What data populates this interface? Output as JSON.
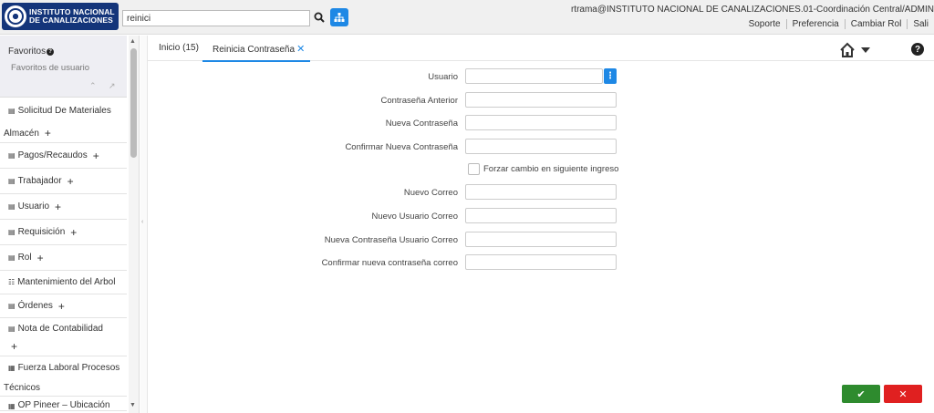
{
  "header": {
    "logo_line1": "INSTITUTO NACIONAL",
    "logo_line2": "DE CANALIZACIONES",
    "search_value": "reinici",
    "user_info": "rtrama@INSTITUTO NACIONAL DE CANALIZACIONES.01-Coordinación Central/ADMIN",
    "links": [
      "Soporte",
      "Preferencia",
      "Cambiar Rol",
      "Sali"
    ]
  },
  "sidebar": {
    "favorites_title": "Favoritos",
    "favorites_subtitle": "Favoritos de usuario",
    "items": [
      {
        "label": "Solicitud De Materiales",
        "label2": "Almacén"
      },
      {
        "label": "Pagos/Recaudos"
      },
      {
        "label": "Trabajador"
      },
      {
        "label": "Usuario"
      },
      {
        "label": "Requisición"
      },
      {
        "label": "Rol"
      },
      {
        "label": "Mantenimiento del Arbol"
      },
      {
        "label": "Órdenes"
      },
      {
        "label": "Nota de Contabilidad"
      },
      {
        "label": "Fuerza Laboral Procesos",
        "label2": "Técnicos"
      },
      {
        "label": "OP Pineer – Ubicación"
      }
    ]
  },
  "tabs": [
    {
      "label": "Inicio (15)"
    },
    {
      "label": "Reinicia Contraseña"
    }
  ],
  "form": {
    "usuario": "Usuario",
    "contrasena_anterior": "Contraseña Anterior",
    "nueva_contrasena": "Nueva Contraseña",
    "confirmar_nueva_contrasena": "Confirmar Nueva Contraseña",
    "forzar_cambio": "Forzar cambio en siguiente ingreso",
    "nuevo_correo": "Nuevo Correo",
    "nuevo_usuario_correo": "Nuevo Usuario Correo",
    "nueva_contrasena_usuario_correo": "Nueva Contraseña Usuario Correo",
    "confirmar_nueva_contrasena_correo": "Confirmar nueva contraseña correo"
  },
  "colors": {
    "accent": "#1e88e5",
    "logo_bg": "#14357a",
    "ok": "#2e8b2e",
    "cancel": "#e02020"
  }
}
